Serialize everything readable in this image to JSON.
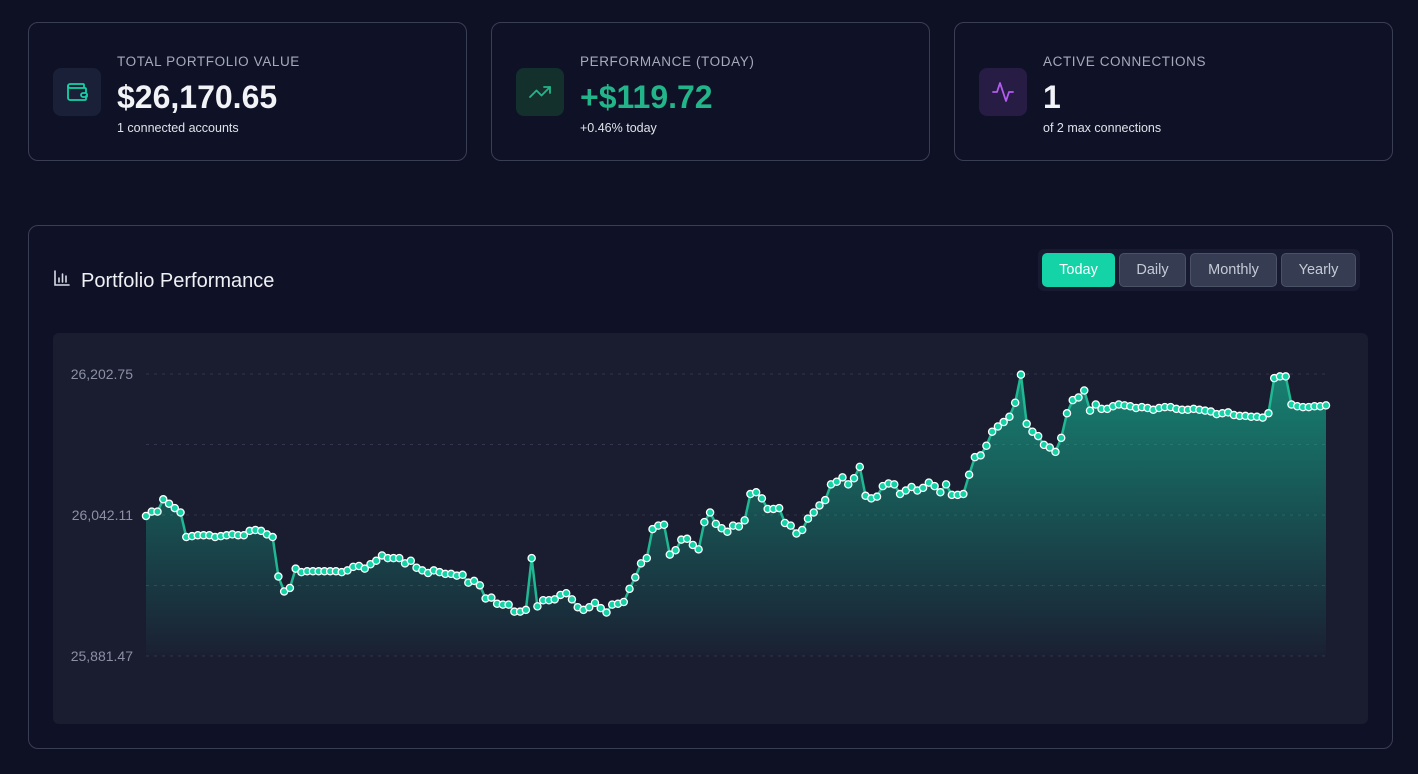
{
  "stats": [
    {
      "label": "TOTAL PORTFOLIO VALUE",
      "value": "$26,170.65",
      "sub": "1 connected accounts",
      "icon": "wallet-icon",
      "accent": "#14d3a6"
    },
    {
      "label": "PERFORMANCE (TODAY)",
      "value": "+$119.72",
      "sub": "+0.46% today",
      "icon": "trending-up-icon",
      "accent": "#22b58a"
    },
    {
      "label": "ACTIVE CONNECTIONS",
      "value": "1",
      "sub": "of 2 max connections",
      "icon": "activity-icon",
      "accent": "#b35cf0"
    }
  ],
  "performance": {
    "title": "Portfolio Performance",
    "tabs": [
      "Today",
      "Daily",
      "Monthly",
      "Yearly"
    ],
    "active_tab": "Today"
  },
  "colors": {
    "accent": "#14d3a6",
    "background": "#0e1024",
    "card_border": "#3a3e55",
    "positive": "#22b58a",
    "purple": "#b35cf0"
  },
  "chart_data": {
    "type": "area",
    "ytick_labels": [
      "26,202.75",
      "26,042.11",
      "25,881.47"
    ],
    "ylim": [
      25881.47,
      26202.75
    ],
    "grid": true,
    "values": [
      26041,
      26046,
      26046,
      26060,
      26055,
      26050,
      26045,
      26017,
      26018,
      26019,
      26019,
      26019,
      26017,
      26018,
      26019,
      26020,
      26019,
      26019,
      26024,
      26025,
      26024,
      26020,
      26017,
      25972,
      25955,
      25959,
      25981,
      25977,
      25978,
      25978,
      25978,
      25978,
      25978,
      25978,
      25977,
      25979,
      25983,
      25984,
      25981,
      25986,
      25990,
      25996,
      25993,
      25993,
      25993,
      25987,
      25990,
      25982,
      25979,
      25976,
      25979,
      25977,
      25975,
      25975,
      25973,
      25974,
      25965,
      25967,
      25962,
      25947,
      25948,
      25941,
      25940,
      25940,
      25932,
      25932,
      25934,
      25993,
      25938,
      25945,
      25945,
      25946,
      25951,
      25953,
      25946,
      25937,
      25934,
      25937,
      25942,
      25936,
      25931,
      25940,
      25941,
      25943,
      25958,
      25971,
      25987,
      25993,
      26026,
      26030,
      26031,
      25997,
      26002,
      26014,
      26015,
      26008,
      26003,
      26034,
      26045,
      26032,
      26027,
      26023,
      26030,
      26029,
      26036,
      26066,
      26068,
      26061,
      26049,
      26049,
      26050,
      26033,
      26030,
      26021,
      26025,
      26038,
      26045,
      26053,
      26059,
      26077,
      26080,
      26085,
      26077,
      26084,
      26097,
      26064,
      26061,
      26063,
      26075,
      26078,
      26077,
      26066,
      26070,
      26074,
      26070,
      26073,
      26079,
      26075,
      26068,
      26077,
      26065,
      26065,
      26066,
      26088,
      26108,
      26110,
      26121,
      26137,
      26143,
      26148,
      26154,
      26170,
      26202,
      26146,
      26137,
      26132,
      26122,
      26119,
      26114,
      26130,
      26158,
      26173,
      26176,
      26184,
      26161,
      26168,
      26163,
      26163,
      26166,
      26168,
      26167,
      26166,
      26164,
      26165,
      26164,
      26162,
      26164,
      26165,
      26165,
      26163,
      26162,
      26162,
      26163,
      26162,
      26161,
      26160,
      26157,
      26158,
      26159,
      26156,
      26155,
      26155,
      26154,
      26154,
      26153,
      26158,
      26198,
      26200,
      26200,
      26168,
      26166,
      26165,
      26165,
      26166,
      26166,
      26167
    ]
  }
}
